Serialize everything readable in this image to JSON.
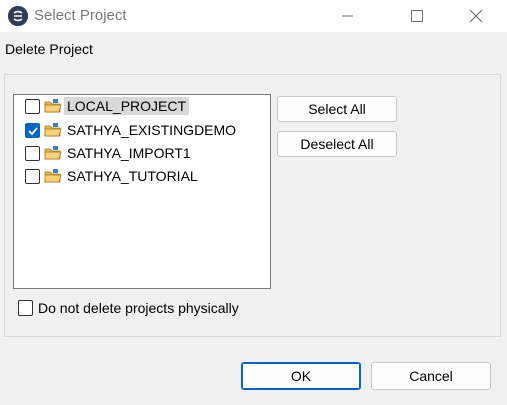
{
  "window": {
    "title": "Select Project",
    "icon": "app-logo-icon",
    "controls": [
      "minimize-icon",
      "maximize-icon",
      "close-icon"
    ]
  },
  "subtitle": "Delete Project",
  "projects": [
    {
      "label": "LOCAL_PROJECT",
      "checked": false,
      "selected": true,
      "icon": "folder-project-icon"
    },
    {
      "label": "SATHYA_EXISTINGDEMO",
      "checked": true,
      "selected": false,
      "icon": "folder-project-icon"
    },
    {
      "label": "SATHYA_IMPORT1",
      "checked": false,
      "selected": false,
      "icon": "folder-project-icon"
    },
    {
      "label": "SATHYA_TUTORIAL",
      "checked": false,
      "selected": false,
      "icon": "folder-project-icon"
    }
  ],
  "buttons": {
    "select_all": "Select All",
    "deselect_all": "Deselect All",
    "ok": "OK",
    "cancel": "Cancel"
  },
  "option": {
    "label": "Do not delete projects physically",
    "checked": false
  },
  "colors": {
    "accent": "#0067c0",
    "background": "#f0f0f0",
    "selection": "#d9d9d9"
  }
}
